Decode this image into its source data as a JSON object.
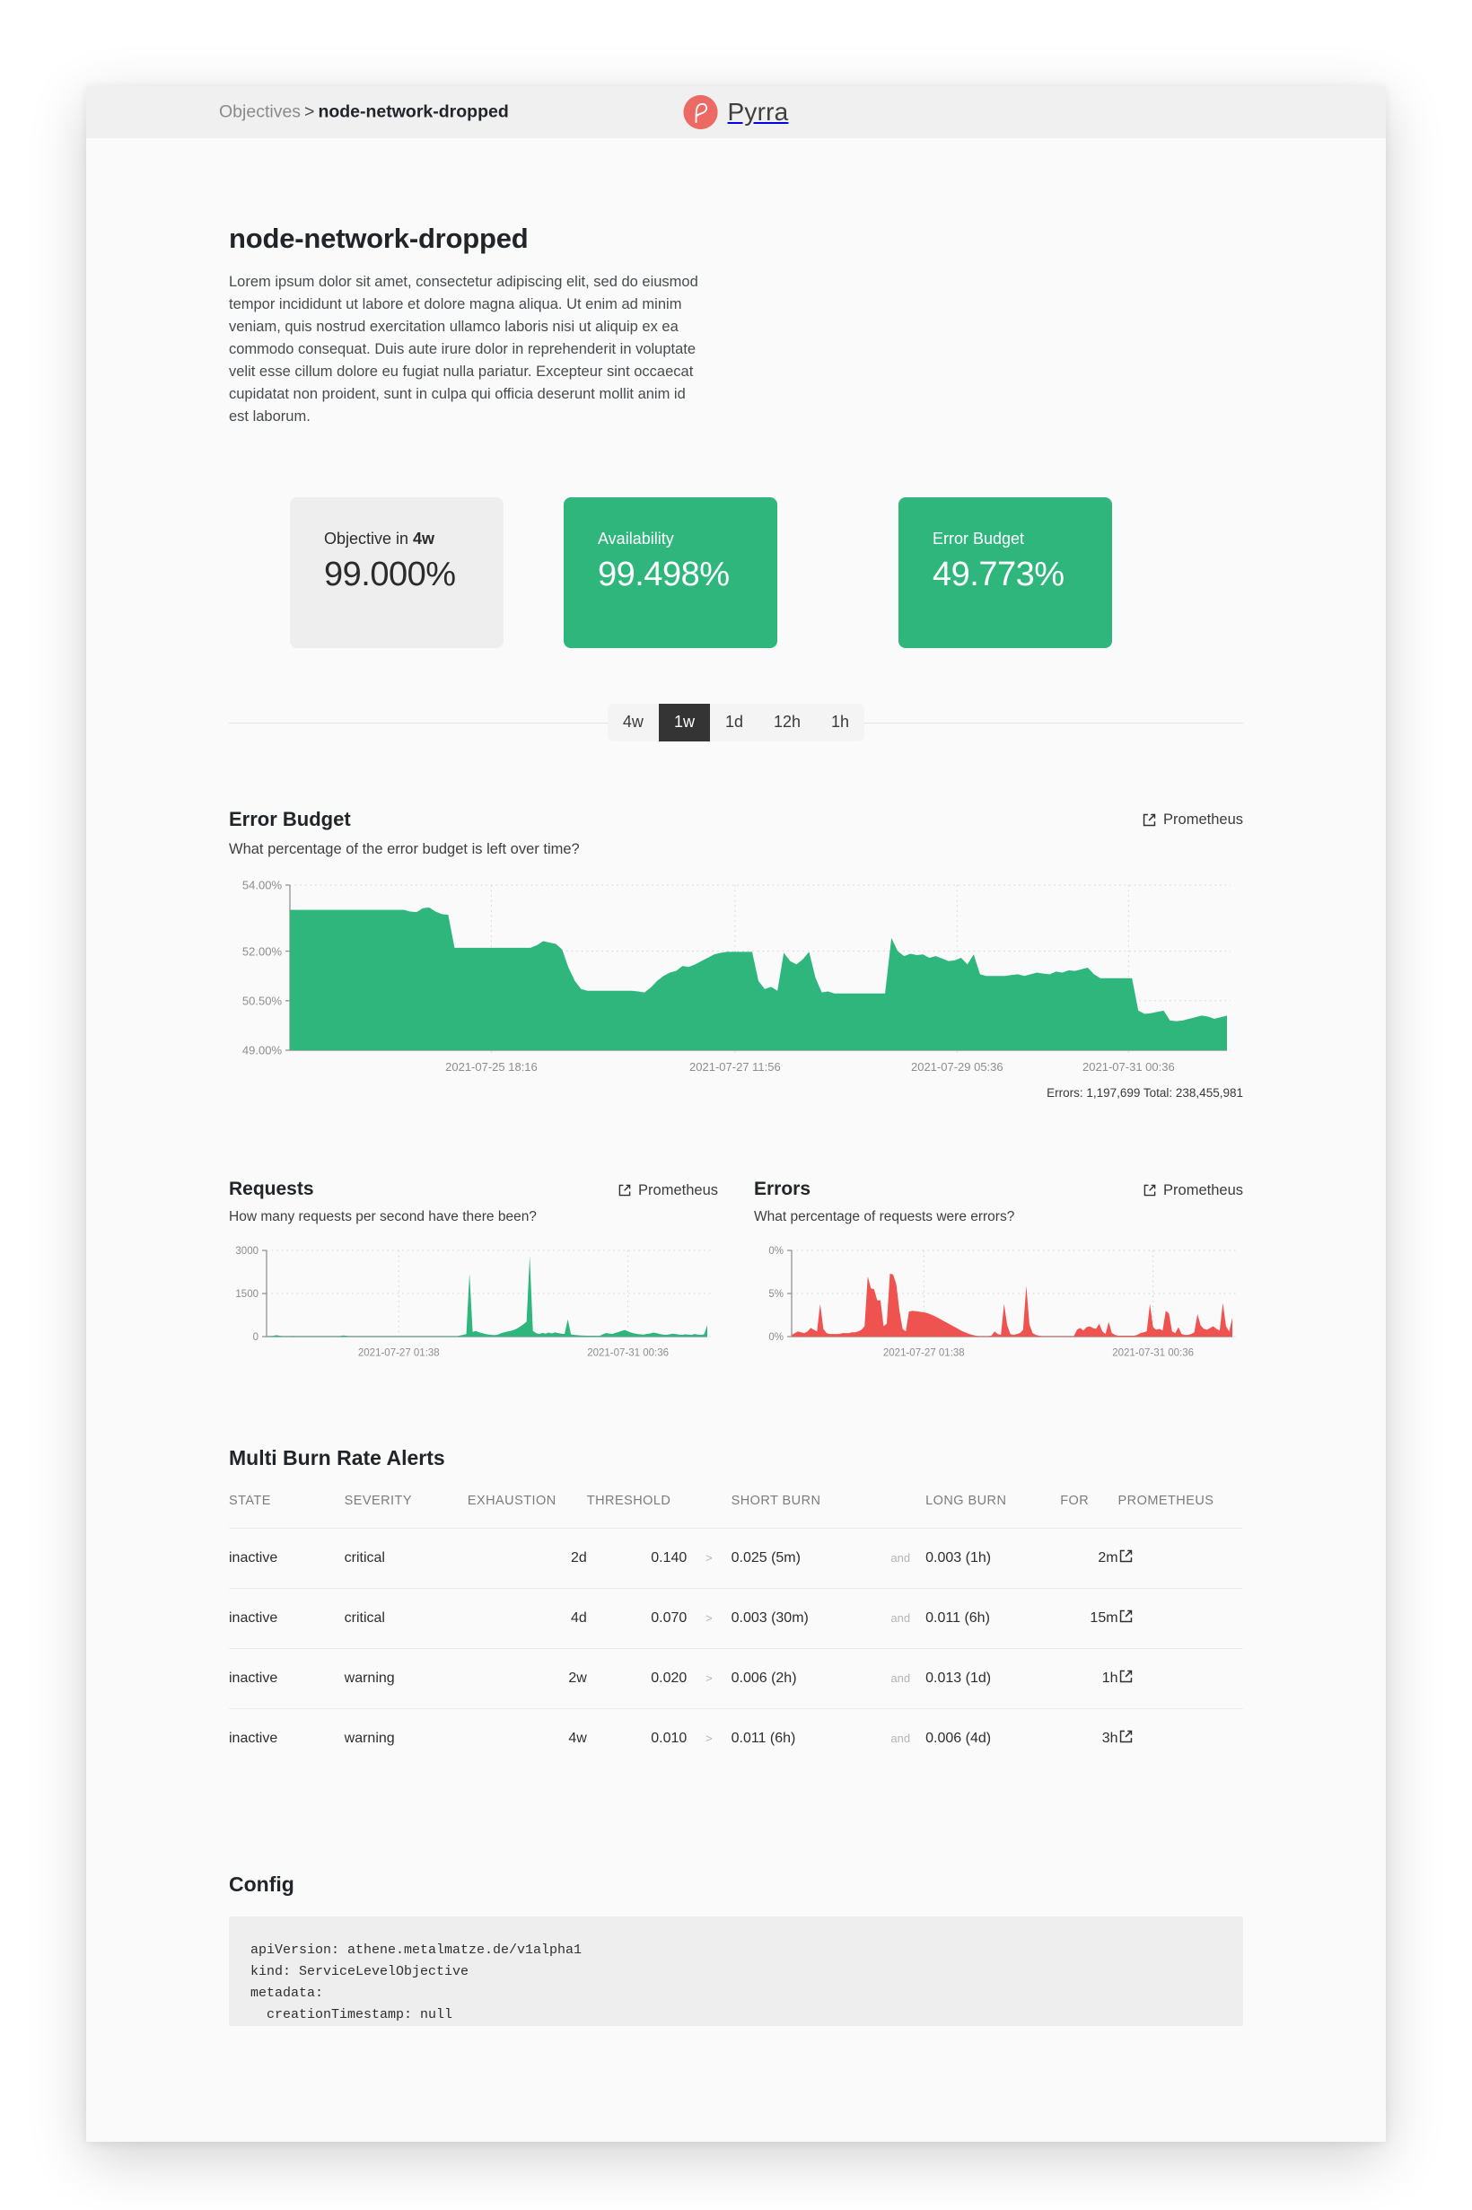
{
  "navbar": {
    "breadcrumb_root": "Objectives",
    "breadcrumb_separator": ">",
    "breadcrumb_current": "node-network-dropped",
    "brand_name": "Pyrra",
    "brand_color": "#ec6a63"
  },
  "objective": {
    "title": "node-network-dropped",
    "description": "Lorem ipsum dolor sit amet, consectetur adipiscing elit, sed do eiusmod tempor incididunt ut labore et dolore magna aliqua. Ut enim ad minim veniam, quis nostrud exercitation ullamco laboris nisi ut aliquip ex ea commodo consequat. Duis aute irure dolor in reprehenderit in voluptate velit esse cillum dolore eu fugiat nulla pariatur. Excepteur sint occaecat cupidatat non proident, sunt in culpa qui officia deserunt mollit anim id est laborum."
  },
  "cards": {
    "objective": {
      "label_prefix": "Objective in ",
      "label_window": "4w",
      "value": "99.000%"
    },
    "availability": {
      "label": "Availability",
      "value": "99.498%"
    },
    "error_budget": {
      "label": "Error Budget",
      "value": "49.773%"
    },
    "green": "#2eb67d",
    "neutral": "#eeeeee"
  },
  "timerange": {
    "options": [
      "4w",
      "1w",
      "1d",
      "12h",
      "1h"
    ],
    "selected": "1w"
  },
  "prometheus_link_label": "Prometheus",
  "chart_data": [
    {
      "type": "area",
      "id": "error-budget",
      "title": "Error Budget",
      "subtitle": "What percentage of the error budget is left over time?",
      "xlabel": "",
      "ylabel": "",
      "grid": true,
      "color": "#2eb67d",
      "ylim": [
        49.0,
        54.0
      ],
      "yticks": [
        49.0,
        50.5,
        52.0,
        54.0
      ],
      "ytick_labels": [
        "49.00%",
        "50.50%",
        "52.00%",
        "54.00%"
      ],
      "xtick_labels": [
        "2021-07-25 18:16",
        "2021-07-27 11:56",
        "2021-07-29 05:36",
        "2021-07-31 00:36"
      ],
      "xtick_positions": [
        0.215,
        0.475,
        0.712,
        0.895
      ],
      "footnote": "Errors: 1,197,699 Total: 238,455,981",
      "values": [
        53.25,
        53.25,
        53.25,
        53.25,
        53.25,
        53.25,
        53.25,
        53.25,
        53.25,
        53.25,
        53.25,
        53.25,
        53.25,
        53.25,
        53.25,
        53.25,
        53.25,
        53.25,
        53.25,
        53.2,
        53.18,
        53.3,
        53.32,
        53.2,
        53.12,
        53.1,
        52.1,
        52.1,
        52.1,
        52.1,
        52.1,
        52.1,
        52.1,
        52.1,
        52.1,
        52.1,
        52.1,
        52.1,
        52.1,
        52.18,
        52.3,
        52.26,
        52.22,
        52.05,
        51.5,
        51.1,
        50.85,
        50.8,
        50.8,
        50.8,
        50.8,
        50.8,
        50.8,
        50.8,
        50.8,
        50.78,
        50.75,
        50.9,
        51.1,
        51.25,
        51.35,
        51.4,
        51.55,
        51.52,
        51.6,
        51.7,
        51.8,
        51.9,
        51.95,
        51.98,
        51.98,
        51.98,
        51.98,
        51.98,
        51.1,
        50.85,
        50.92,
        50.8,
        51.95,
        51.7,
        51.6,
        51.75,
        51.98,
        51.2,
        50.75,
        50.78,
        50.72,
        50.72,
        50.72,
        50.72,
        50.72,
        50.72,
        50.72,
        50.72,
        50.72,
        52.4,
        52.0,
        51.85,
        51.92,
        51.88,
        51.9,
        51.8,
        51.85,
        51.78,
        51.7,
        51.72,
        51.8,
        51.6,
        51.9,
        51.3,
        51.25,
        51.25,
        51.25,
        51.25,
        51.28,
        51.3,
        51.25,
        51.3,
        51.35,
        51.32,
        51.3,
        51.38,
        51.35,
        51.42,
        51.4,
        51.45,
        51.5,
        51.3,
        51.18,
        51.18,
        51.18,
        51.18,
        51.18,
        51.18,
        50.2,
        50.1,
        50.12,
        50.16,
        50.2,
        49.9,
        49.88,
        49.9,
        49.95,
        50.0,
        50.05,
        50.02,
        49.95,
        50.0,
        50.05
      ]
    },
    {
      "type": "area",
      "id": "requests",
      "title": "Requests",
      "subtitle": "How many requests per second have there been?",
      "grid": true,
      "color": "#2eb67d",
      "ylim": [
        0,
        3000
      ],
      "yticks": [
        0,
        1500,
        3000
      ],
      "ytick_labels": [
        "0",
        "1500",
        "3000"
      ],
      "xtick_labels": [
        "2021-07-27 01:38",
        "2021-07-31 00:36"
      ],
      "xtick_positions": [
        0.3,
        0.82
      ],
      "values": [
        10,
        12,
        18,
        50,
        30,
        14,
        12,
        10,
        18,
        14,
        10,
        10,
        12,
        10,
        10,
        10,
        12,
        10,
        10,
        10,
        10,
        10,
        12,
        10,
        40,
        30,
        12,
        10,
        10,
        10,
        10,
        10,
        10,
        10,
        10,
        10,
        10,
        10,
        10,
        10,
        10,
        10,
        10,
        10,
        10,
        12,
        14,
        10,
        10,
        10,
        10,
        10,
        12,
        10,
        10,
        10,
        12,
        12,
        10,
        10,
        12,
        40,
        60,
        90,
        2200,
        160,
        200,
        150,
        120,
        90,
        70,
        60,
        50,
        70,
        120,
        150,
        180,
        200,
        230,
        280,
        350,
        430,
        520,
        2800,
        200,
        120,
        90,
        130,
        100,
        140,
        110,
        150,
        120,
        100,
        90,
        600,
        80,
        60,
        50,
        40,
        35,
        30,
        28,
        30,
        28,
        25,
        80,
        120,
        110,
        90,
        130,
        160,
        200,
        230,
        180,
        140,
        110,
        90,
        80,
        70,
        95,
        110,
        140,
        120,
        90,
        70,
        60,
        80,
        100,
        90,
        70,
        60,
        80,
        70,
        60,
        90,
        70,
        60,
        80,
        400
      ]
    },
    {
      "type": "area",
      "id": "errors",
      "title": "Errors",
      "subtitle": "What percentage of requests were errors?",
      "grid": true,
      "color": "#ef5350",
      "ylim": [
        0,
        10
      ],
      "yticks": [
        0,
        5,
        10
      ],
      "ytick_labels": [
        "0%",
        "5%",
        "0%"
      ],
      "xtick_labels": [
        "2021-07-27 01:38",
        "2021-07-31 00:36"
      ],
      "xtick_positions": [
        0.3,
        0.82
      ],
      "values": [
        0.2,
        0.4,
        0.6,
        0.5,
        0.4,
        0.6,
        1.0,
        0.8,
        0.6,
        3.8,
        0.9,
        0.4,
        0.3,
        0.3,
        0.3,
        0.3,
        0.4,
        0.4,
        0.4,
        0.5,
        0.5,
        0.6,
        0.8,
        1.2,
        7.0,
        5.6,
        5.5,
        4.2,
        4.2,
        1.2,
        1.5,
        7.3,
        7.2,
        6.1,
        3.0,
        0.9,
        0.6,
        2.9,
        3.0,
        2.95,
        2.9,
        2.85,
        2.8,
        2.7,
        2.55,
        2.4,
        2.2,
        2.0,
        1.8,
        1.6,
        1.4,
        1.2,
        1.0,
        0.8,
        0.6,
        0.45,
        0.3,
        0.2,
        0.1,
        0.05,
        0.05,
        0.05,
        0.05,
        0.1,
        0.6,
        0.3,
        0.2,
        3.8,
        1.3,
        0.3,
        0.2,
        0.3,
        0.4,
        0.8,
        5.9,
        1.4,
        0.4,
        0.2,
        0.1,
        0.05,
        0.05,
        0.05,
        0.05,
        0.05,
        0.05,
        0.05,
        0.05,
        0.05,
        0.05,
        0.05,
        0.8,
        1.0,
        0.7,
        1.1,
        1.2,
        1.0,
        0.9,
        1.5,
        0.6,
        0.3,
        1.7,
        0.4,
        0.2,
        0.1,
        0.1,
        0.1,
        0.1,
        0.1,
        0.1,
        0.2,
        0.4,
        0.5,
        0.6,
        3.8,
        1.1,
        0.8,
        0.9,
        0.7,
        3.0,
        2.7,
        0.6,
        0.4,
        1.1,
        0.3,
        0.2,
        0.2,
        0.3,
        0.5,
        2.6,
        1.3,
        0.9,
        0.8,
        1.0,
        1.2,
        0.9,
        0.7,
        3.9,
        1.2,
        0.6,
        2.2
      ]
    }
  ],
  "alerts": {
    "title": "Multi Burn Rate Alerts",
    "columns": [
      "STATE",
      "SEVERITY",
      "EXHAUSTION",
      "THRESHOLD",
      "SHORT BURN",
      "LONG BURN",
      "FOR",
      "PROMETHEUS"
    ],
    "operator": ">",
    "conjunction": "and",
    "rows": [
      {
        "state": "inactive",
        "severity": "critical",
        "exhaustion": "2d",
        "threshold": "0.140",
        "short_burn": "0.025 (5m)",
        "long_burn": "0.003 (1h)",
        "for": "2m"
      },
      {
        "state": "inactive",
        "severity": "critical",
        "exhaustion": "4d",
        "threshold": "0.070",
        "short_burn": "0.003 (30m)",
        "long_burn": "0.011 (6h)",
        "for": "15m"
      },
      {
        "state": "inactive",
        "severity": "warning",
        "exhaustion": "2w",
        "threshold": "0.020",
        "short_burn": "0.006 (2h)",
        "long_burn": "0.013 (1d)",
        "for": "1h"
      },
      {
        "state": "inactive",
        "severity": "warning",
        "exhaustion": "4w",
        "threshold": "0.010",
        "short_burn": "0.011 (6h)",
        "long_burn": "0.006 (4d)",
        "for": "3h"
      }
    ]
  },
  "config": {
    "title": "Config",
    "yaml": "apiVersion: athene.metalmatze.de/v1alpha1\nkind: ServiceLevelObjective\nmetadata:\n  creationTimestamp: null\n  labels:"
  }
}
